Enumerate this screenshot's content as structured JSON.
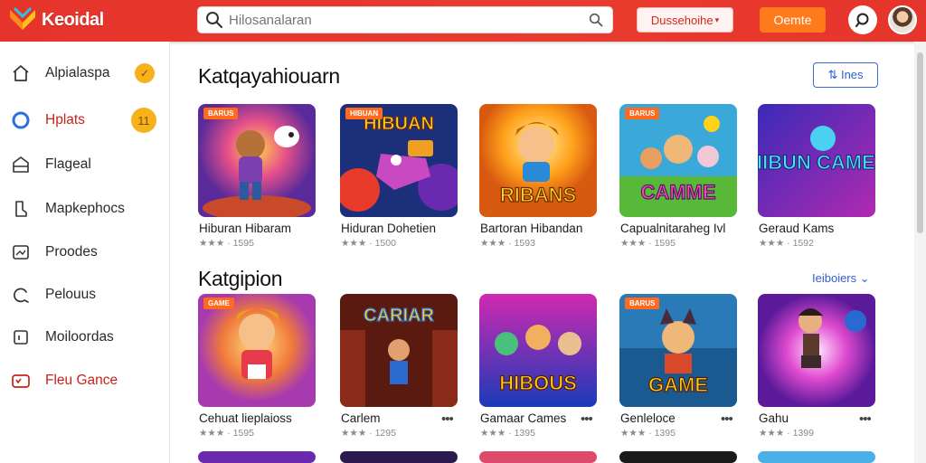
{
  "header": {
    "brand": "Keoidal",
    "search_placeholder": "Hilosanalaran",
    "category_button": "Dussehoihe",
    "category_caret": "▾",
    "game_button": "Oemte"
  },
  "sidebar": {
    "items": [
      {
        "label": "Alpialaspa",
        "icon": "home-icon",
        "badge": "✓"
      },
      {
        "label": "Hplats",
        "icon": "circle-icon",
        "badge": "11",
        "active": true
      },
      {
        "label": "Flageal",
        "icon": "store-icon"
      },
      {
        "label": "Mapkephocs",
        "icon": "bookmark-icon"
      },
      {
        "label": "Proodes",
        "icon": "image-icon"
      },
      {
        "label": "Pelouus",
        "icon": "swirl-icon"
      },
      {
        "label": "Moiloordas",
        "icon": "box-icon"
      },
      {
        "label": "Fleu Gance",
        "icon": "gamepad-icon",
        "red": true
      }
    ]
  },
  "sections": [
    {
      "title": "Katqayahiouarn",
      "action": "⇅ Ines",
      "cards": [
        {
          "tag": "BARUS",
          "title": "Hiburan Hibaram",
          "meta": "★★★ · 1595"
        },
        {
          "tag": "HIBUAN",
          "title": "Hiduran Dohetien",
          "meta": "★★★ · 1500"
        },
        {
          "tag": "",
          "title": "Bartoran Hibandan",
          "meta": "★★★ · 1593"
        },
        {
          "tag": "BARUS",
          "title": "Capualnitaraheg Ivl",
          "meta": "★★★ · 1595"
        },
        {
          "tag": "",
          "title": "Geraud Kams",
          "meta": "★★★ · 1592"
        }
      ]
    },
    {
      "title": "Katgipion",
      "action": "Ieiboiers ⌄",
      "cards": [
        {
          "tag": "GAME",
          "title": "Cehuat lieplaioss",
          "meta": "★★★ · 1595"
        },
        {
          "tag": "",
          "title": "Carlem",
          "meta": "★★★ · 1295",
          "more": "•••"
        },
        {
          "tag": "",
          "title": "Gamaar Cames",
          "meta": "★★★ · 1395",
          "more": "•••"
        },
        {
          "tag": "BARUS",
          "title": "Genleloce",
          "meta": "★★★ · 1395",
          "more": "•••"
        },
        {
          "tag": "",
          "title": "Gahu",
          "meta": "★★★ · 1399",
          "more": "•••"
        }
      ]
    }
  ],
  "thumb_texts": [
    "",
    "HIBUAN",
    "RIBANS",
    "CAMME",
    "FIIBUN CAMES",
    "",
    "CARIAR",
    "HIBOUS",
    "GAME",
    ""
  ],
  "colors": {
    "brand_red": "#e5342b",
    "accent_orange": "#ff7a1a",
    "link_blue": "#2f5fcf",
    "badge_yellow": "#f6b21a"
  }
}
